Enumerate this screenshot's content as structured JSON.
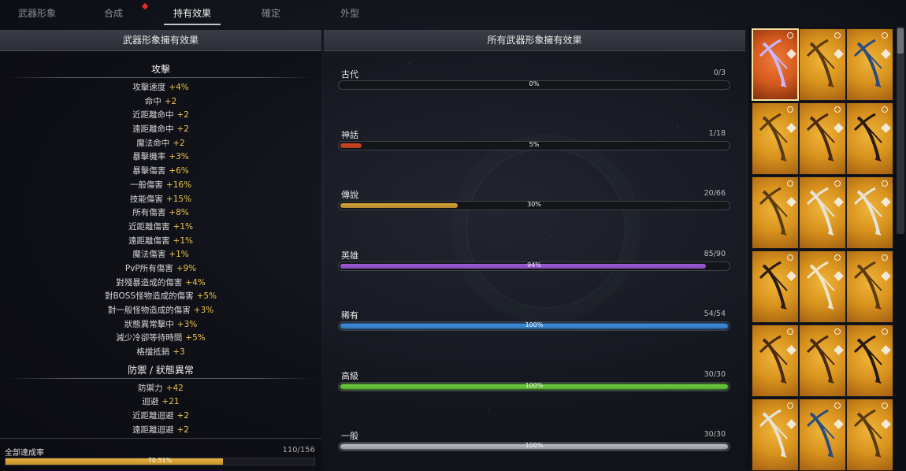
{
  "nav": {
    "tabs": [
      {
        "label": "武器形象",
        "active": false
      },
      {
        "label": "合成",
        "active": false
      },
      {
        "label": "持有效果",
        "active": true
      },
      {
        "label": "確定",
        "active": false
      },
      {
        "label": "外型",
        "active": false
      }
    ]
  },
  "left": {
    "header": "武器形象擁有效果",
    "attack_title": "攻擊",
    "attack_stats": [
      {
        "name": "攻擊速度",
        "value": "+4%"
      },
      {
        "name": "命中",
        "value": "+2"
      },
      {
        "name": "近距離命中",
        "value": "+2"
      },
      {
        "name": "遠距離命中",
        "value": "+2"
      },
      {
        "name": "魔法命中",
        "value": "+2"
      },
      {
        "name": "暴擊機率",
        "value": "+3%"
      },
      {
        "name": "暴擊傷害",
        "value": "+6%"
      },
      {
        "name": "一般傷害",
        "value": "+16%"
      },
      {
        "name": "技能傷害",
        "value": "+15%"
      },
      {
        "name": "所有傷害",
        "value": "+8%"
      },
      {
        "name": "近距離傷害",
        "value": "+1%"
      },
      {
        "name": "遠距離傷害",
        "value": "+1%"
      },
      {
        "name": "魔法傷害",
        "value": "+1%"
      },
      {
        "name": "PvP所有傷害",
        "value": "+9%"
      },
      {
        "name": "對殘暴造成的傷害",
        "value": "+4%"
      },
      {
        "name": "對BOSS怪物造成的傷害",
        "value": "+5%"
      },
      {
        "name": "對一般怪物造成的傷害",
        "value": "+3%"
      },
      {
        "name": "狀態異常擊中",
        "value": "+3%"
      },
      {
        "name": "減少冷卻等待時間",
        "value": "+5%"
      },
      {
        "name": "格擋抵銷",
        "value": "+3"
      }
    ],
    "defense_title": "防禦 / 狀態異常",
    "defense_stats": [
      {
        "name": "防禦力",
        "value": "+42"
      },
      {
        "name": "迴避",
        "value": "+21"
      },
      {
        "name": "近距離迴避",
        "value": "+2"
      },
      {
        "name": "遠距離迴避",
        "value": "+2"
      }
    ],
    "footer": {
      "label": "全部達成率",
      "count": "110/156",
      "percent_text": "70.51%",
      "fraction": 0.7051
    }
  },
  "middle": {
    "header": "所有武器形象擁有效果",
    "rarities": [
      {
        "name": "古代",
        "count": "0/3",
        "percent": "0%",
        "fraction": 0.0,
        "color": "#7a7d86"
      },
      {
        "name": "神話",
        "count": "1/18",
        "percent": "5%",
        "fraction": 0.055,
        "color": "#d3471f"
      },
      {
        "name": "傳說",
        "count": "20/66",
        "percent": "30%",
        "fraction": 0.303,
        "color": "#d9a437"
      },
      {
        "name": "英雄",
        "count": "85/90",
        "percent": "94%",
        "fraction": 0.944,
        "color": "#a05ad8"
      },
      {
        "name": "稀有",
        "count": "54/54",
        "percent": "100%",
        "fraction": 1.0,
        "color": "#3f8ee0"
      },
      {
        "name": "高級",
        "count": "30/30",
        "percent": "100%",
        "fraction": 1.0,
        "color": "#6ccf3c"
      },
      {
        "name": "一般",
        "count": "30/30",
        "percent": "100%",
        "fraction": 1.0,
        "color": "#b9bcc4"
      }
    ]
  },
  "grid": {
    "cells": [
      {
        "weapon": "purple-crossbow-icon",
        "selected": true
      },
      {
        "weapon": "gold-crossbow-icon",
        "selected": false
      },
      {
        "weapon": "blue-crossbow-icon",
        "selected": false
      },
      {
        "weapon": "gold-crossbow-icon",
        "selected": false
      },
      {
        "weapon": "bronze-crossbow-icon",
        "selected": false
      },
      {
        "weapon": "dark-crossbow-icon",
        "selected": false
      },
      {
        "weapon": "gold-crossbow-icon",
        "selected": false
      },
      {
        "weapon": "silver-crossbow-icon",
        "selected": false
      },
      {
        "weapon": "silver-crossbow-icon",
        "selected": false
      },
      {
        "weapon": "dark-crossbow-icon",
        "selected": false
      },
      {
        "weapon": "bone-crossbow-icon",
        "selected": false
      },
      {
        "weapon": "gold-crossbow-icon",
        "selected": false
      },
      {
        "weapon": "bronze-crossbow-icon",
        "selected": false
      },
      {
        "weapon": "bronze-crossbow-icon",
        "selected": false
      },
      {
        "weapon": "dark-crossbow-icon",
        "selected": false
      },
      {
        "weapon": "silver-crossbow-icon",
        "selected": false
      },
      {
        "weapon": "blue-crossbow-icon",
        "selected": false
      },
      {
        "weapon": "gold-crossbow-icon",
        "selected": false
      }
    ]
  }
}
